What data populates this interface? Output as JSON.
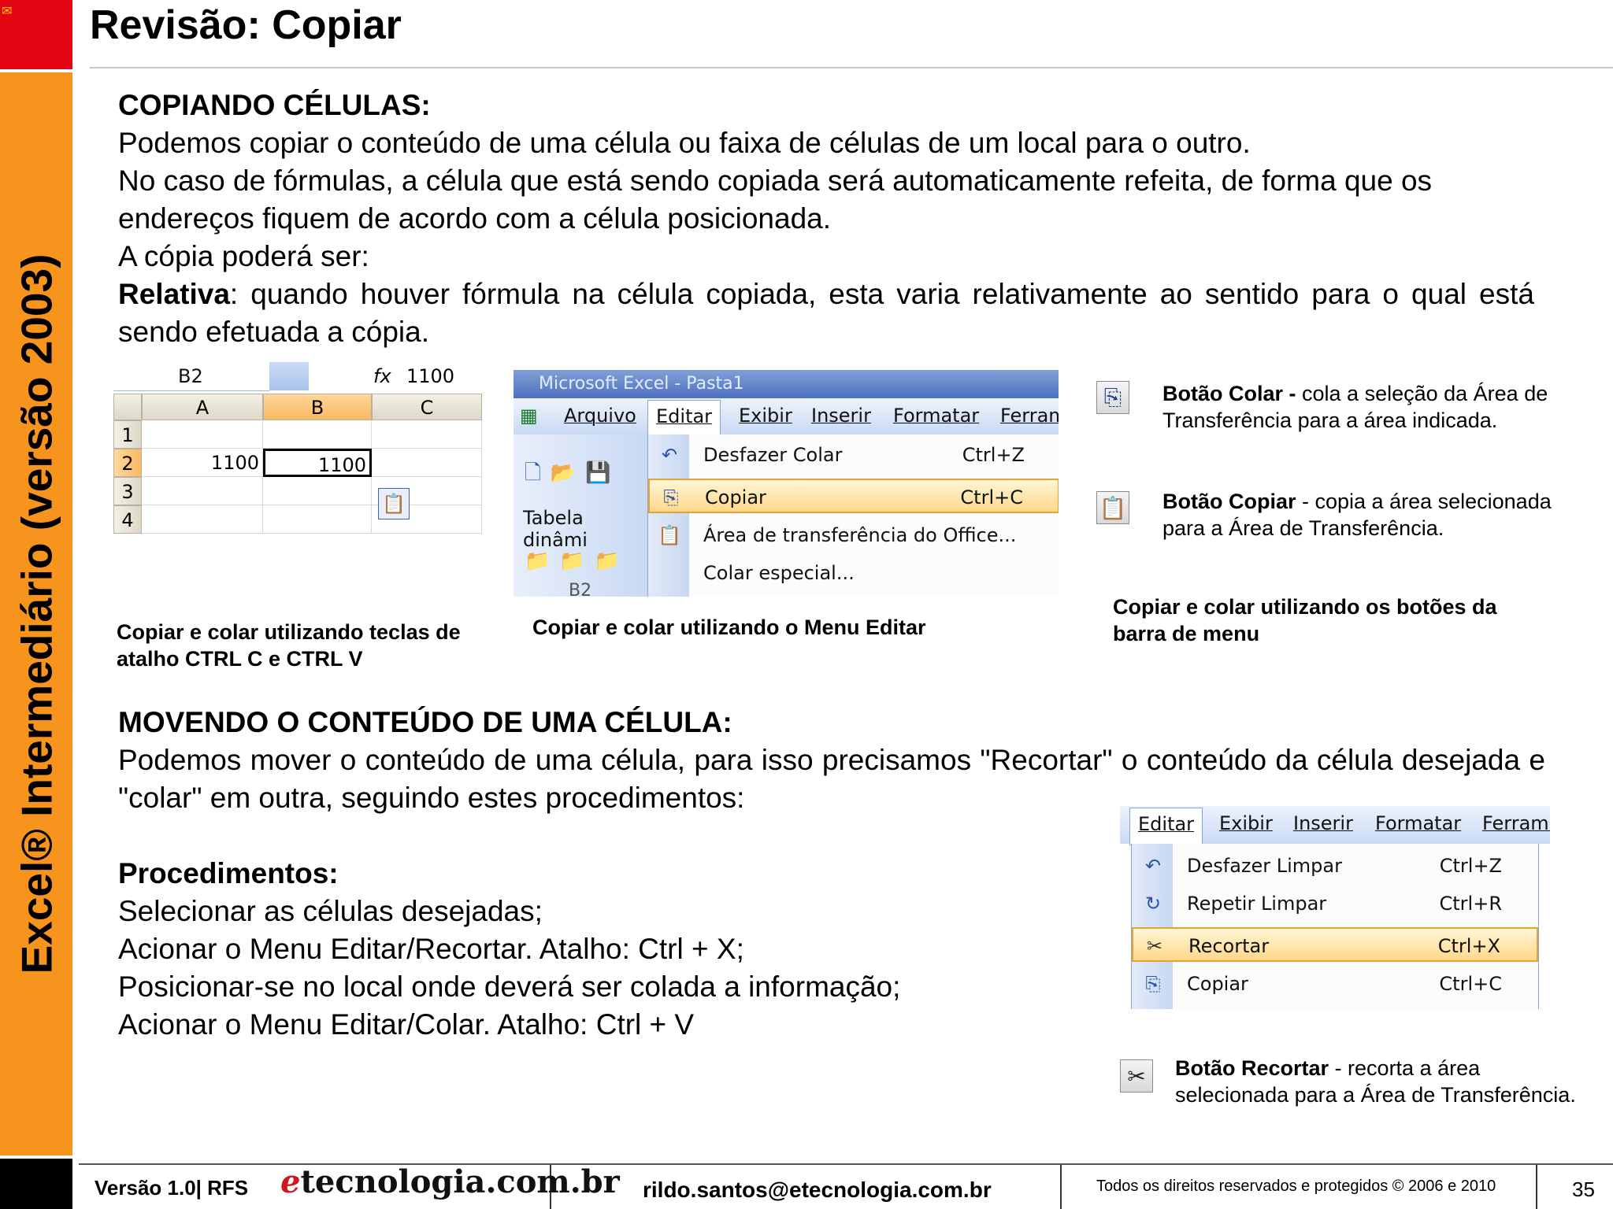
{
  "sidebar": {
    "vertical_title": "Excel® Intermediário (versão 2003)"
  },
  "header": {
    "title": "Revisão: Copiar"
  },
  "copy_section": {
    "heading": "COPIANDO CÉLULAS:",
    "lines": [
      "Podemos copiar o conteúdo de uma célula ou faixa de células de um local para o outro.",
      "No caso de fórmulas, a célula que está sendo copiada será automaticamente refeita, de forma que os endereços fiquem de acordo com a célula posicionada.",
      "A cópia poderá ser:"
    ],
    "relativa_bold": "Relativa",
    "relativa_text": ": quando houver fórmula na célula copiada, esta varia relativamente ao sentido para o qual está sendo efetuada a cópia."
  },
  "sheet": {
    "name_box": "B2",
    "fx": "fx",
    "formula_value": "1100",
    "columns": [
      "A",
      "B",
      "C"
    ],
    "rows": [
      "1",
      "2",
      "3",
      "4"
    ],
    "a2": "1100",
    "b2": "1100"
  },
  "menu_editar": {
    "window_title": "Microsoft Excel - Pasta1",
    "menubar": [
      "Arquivo",
      "Editar",
      "Exibir",
      "Inserir",
      "Formatar",
      "Ferram"
    ],
    "items": [
      {
        "label": "Desfazer Colar",
        "shortcut": "Ctrl+Z"
      },
      {
        "label": "Copiar",
        "shortcut": "Ctrl+C"
      },
      {
        "label": "Área de transferência do Office...",
        "shortcut": ""
      },
      {
        "label": "Colar especial...",
        "shortcut": ""
      }
    ],
    "toolbar_label": "Tabela dinâmi",
    "cell_ref": "B2"
  },
  "captions": {
    "shortcuts": "Copiar e colar utilizando teclas de atalho CTRL C e CTRL V",
    "menu": "Copiar e colar utilizando o Menu Editar",
    "buttons": "Copiar e colar utilizando os botões da barra de menu"
  },
  "buttons_info": {
    "colar_bold": "Botão Colar -",
    "colar_text": " cola a seleção da Área de Transferência para a área indicada.",
    "copiar_bold": "Botão Copiar",
    "copiar_text": " - copia a área selecionada para a Área de Transferência.",
    "recortar_bold": "Botão Recortar",
    "recortar_text": " - recorta a área selecionada para a Área de Transferência."
  },
  "move_section": {
    "heading": "MOVENDO O CONTEÚDO DE UMA CÉLULA:",
    "text": "Podemos mover o conteúdo de uma célula, para isso precisamos \"Recortar\" o conteúdo da célula desejada e \"colar\" em outra, seguindo estes procedimentos:",
    "proc_heading": "Procedimentos:",
    "steps": [
      "Selecionar as células desejadas;",
      "Acionar o Menu Editar/Recortar. Atalho: Ctrl + X;",
      "Posicionar-se no local onde deverá ser colada a informação;",
      "Acionar o Menu Editar/Colar. Atalho: Ctrl + V"
    ]
  },
  "menu_recortar": {
    "menubar": [
      "Editar",
      "Exibir",
      "Inserir",
      "Formatar",
      "Ferrame"
    ],
    "items": [
      {
        "label": "Desfazer Limpar",
        "shortcut": "Ctrl+Z"
      },
      {
        "label": "Repetir Limpar",
        "shortcut": "Ctrl+R"
      },
      {
        "label": "Recortar",
        "shortcut": "Ctrl+X"
      },
      {
        "label": "Copiar",
        "shortcut": "Ctrl+C"
      }
    ]
  },
  "footer": {
    "version": "Versão 1.0| RFS",
    "logo_e": "e",
    "logo_rest": "tecnologia.com.br",
    "email": "rildo.santos@etecnologia.com.br",
    "rights": "Todos os direitos reservados e protegidos © 2006 e 2010",
    "page": "35"
  },
  "colors": {
    "sidebar_orange": "#f7941d",
    "corner_red": "#e30613",
    "highlight": "#ffd88a"
  }
}
